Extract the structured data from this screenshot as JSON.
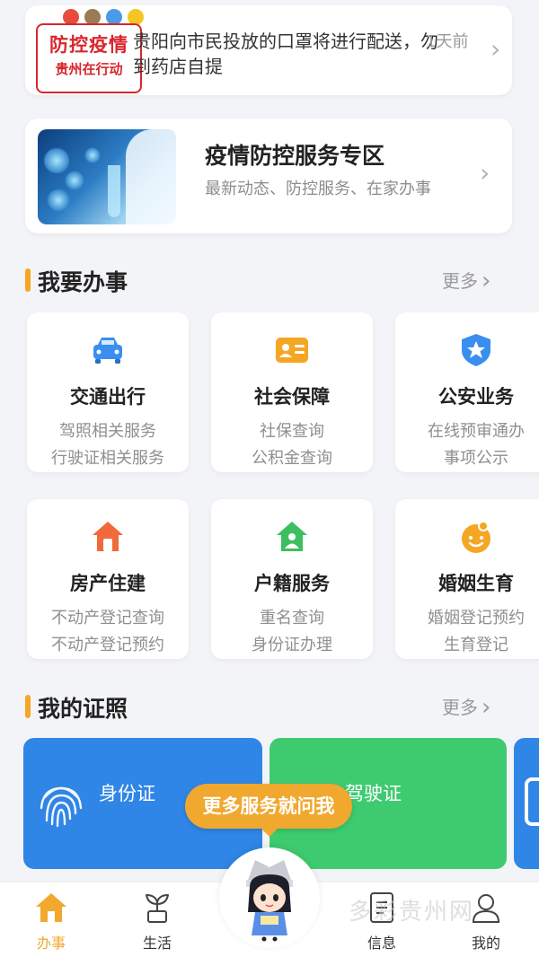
{
  "news": {
    "badge_line1": "防控疫情",
    "badge_line2": "贵州在行动",
    "text": "贵阳向市民投放的口罩将进行配送，勿到药店自提",
    "time": "1天前"
  },
  "covid_zone": {
    "title": "疫情防控服务专区",
    "subtitle": "最新动态、防控服务、在家办事"
  },
  "section_tasks": {
    "title": "我要办事",
    "more": "更多"
  },
  "services": [
    {
      "name": "交通出行",
      "d1": "驾照相关服务",
      "d2": "行驶证相关服务",
      "icon": "car-icon",
      "color": "#3a8ef0"
    },
    {
      "name": "社会保障",
      "d1": "社保查询",
      "d2": "公积金查询",
      "icon": "id-card-icon",
      "color": "#f5a623"
    },
    {
      "name": "公安业务",
      "d1": "在线预审通办",
      "d2": "事项公示",
      "icon": "police-badge-icon",
      "color": "#3a8ef0"
    },
    {
      "name": "房产住建",
      "d1": "不动产登记查询",
      "d2": "不动产登记预约",
      "icon": "house-icon",
      "color": "#f06a3c"
    },
    {
      "name": "户籍服务",
      "d1": "重名查询",
      "d2": "身份证办理",
      "icon": "household-icon",
      "color": "#3dbf5f"
    },
    {
      "name": "婚姻生育",
      "d1": "婚姻登记预约",
      "d2": "生育登记",
      "icon": "baby-icon",
      "color": "#f5a623"
    }
  ],
  "section_licenses": {
    "title": "我的证照",
    "more": "更多"
  },
  "licenses": [
    {
      "name": "身份证",
      "color": "#2f86e6"
    },
    {
      "name": "驾驶证",
      "color": "#3ecb70"
    }
  ],
  "assistant_bubble": "更多服务就问我",
  "tabs": [
    {
      "label": "办事",
      "icon": "home-icon",
      "active": true
    },
    {
      "label": "生活",
      "icon": "sprout-icon",
      "active": false
    },
    {
      "label": "信息",
      "icon": "document-icon",
      "active": false
    },
    {
      "label": "我的",
      "icon": "user-icon",
      "active": false
    }
  ],
  "colors": {
    "accent": "#f0a82f",
    "badge_red": "#d9262c",
    "section_bar": "#f5a623"
  },
  "watermark": "多彩贵州网"
}
